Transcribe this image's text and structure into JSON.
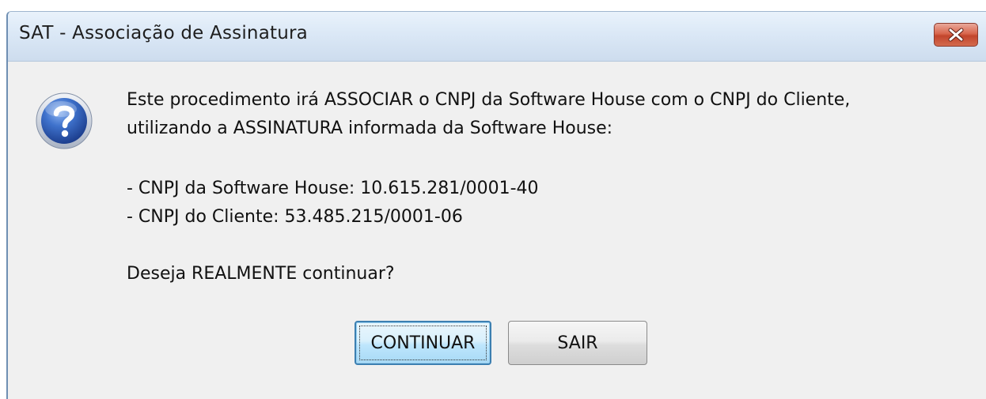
{
  "window": {
    "title": "SAT - Associação de Assinatura",
    "close_icon": "close-x-icon"
  },
  "dialog": {
    "icon": "question-icon",
    "lines": [
      "Este procedimento irá ASSOCIAR o CNPJ da Software House com o CNPJ do Cliente,",
      "utilizando a ASSINATURA informada da Software House:",
      "- CNPJ da Software House: 10.615.281/0001-40",
      "- CNPJ do Cliente: 53.485.215/0001-06",
      "Deseja REALMENTE continuar?"
    ]
  },
  "buttons": {
    "continue_label": "CONTINUAR",
    "exit_label": "SAIR"
  },
  "colors": {
    "titlebar": "#dbe8f6",
    "close_button": "#c2452c",
    "icon_blue": "#2f5fb8",
    "focused_button_border": "#3c7fb1"
  }
}
